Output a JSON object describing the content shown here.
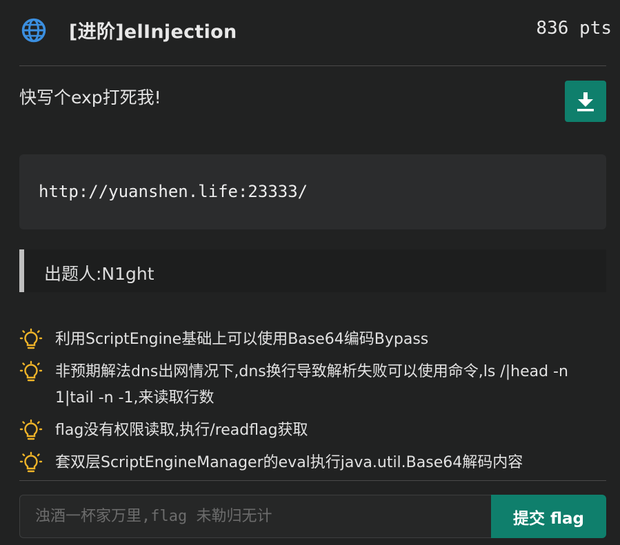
{
  "challenge": {
    "title": "[进阶]elInjection",
    "points": "836 pts",
    "description": "快写个exp打死我!",
    "url": "http://yuanshen.life:23333/",
    "author": "出题人:N1ght"
  },
  "hints": [
    "利用ScriptEngine基础上可以使用Base64编码Bypass",
    "非预期解法dns出网情况下,dns换行导致解析失败可以使用命令,ls /|head -n 1|tail -n -1,来读取行数",
    "flag没有权限读取,执行/readflag获取",
    "套双层ScriptEngineManager的eval执行java.util.Base64解码内容"
  ],
  "flag_form": {
    "placeholder": "浊酒一杯家万里,flag 未勒归无计",
    "submit_label": "提交 flag"
  },
  "colors": {
    "accent": "#0f7f6c",
    "globe": "#3b8fe0",
    "bulb": "#f0b429",
    "background": "#212222"
  },
  "icons": {
    "category": "globe-icon",
    "download": "download-icon",
    "hint": "lightbulb-icon"
  }
}
